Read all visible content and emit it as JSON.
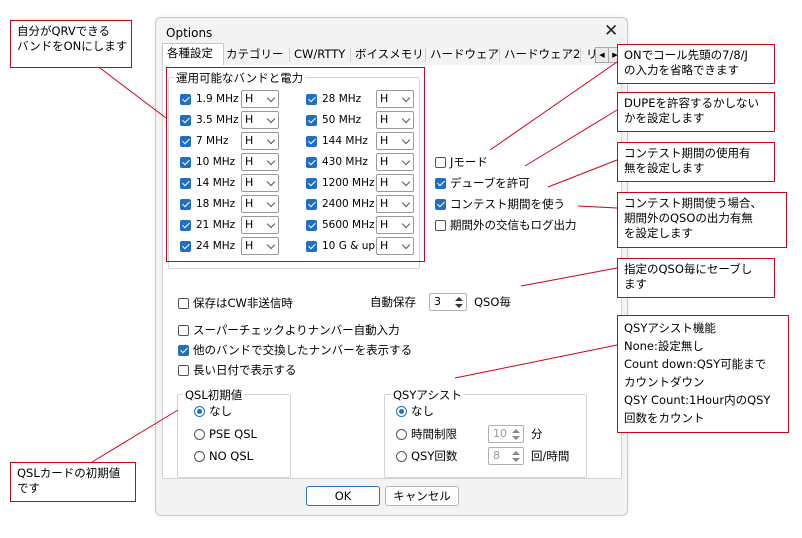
{
  "dialog": {
    "title": "Options",
    "close_glyph": "✕",
    "tabs": [
      "各種設定",
      "カテゴリー",
      "CW/RTTY",
      "ボイスメモリ",
      "ハードウェア",
      "ハードウェア2",
      "リ"
    ],
    "tab_left_glyph": "◀",
    "tab_right_glyph": "▶"
  },
  "bands": {
    "legend": "運用可能なバンドと電力",
    "left": [
      {
        "label": "1.9 MHz",
        "power": "H"
      },
      {
        "label": "3.5 MHz",
        "power": "H"
      },
      {
        "label": "7 MHz",
        "power": "H"
      },
      {
        "label": "10 MHz",
        "power": "H"
      },
      {
        "label": "14 MHz",
        "power": "H"
      },
      {
        "label": "18 MHz",
        "power": "H"
      },
      {
        "label": "21 MHz",
        "power": "H"
      },
      {
        "label": "24 MHz",
        "power": "H"
      }
    ],
    "right": [
      {
        "label": "28 MHz",
        "power": "H"
      },
      {
        "label": "50 MHz",
        "power": "H"
      },
      {
        "label": "144 MHz",
        "power": "H"
      },
      {
        "label": "430 MHz",
        "power": "H"
      },
      {
        "label": "1200 MHz",
        "power": "H"
      },
      {
        "label": "2400 MHz",
        "power": "H"
      },
      {
        "label": "5600 MHz",
        "power": "H"
      },
      {
        "label": "10 G & up",
        "power": "H"
      }
    ]
  },
  "options": {
    "j_mode": "Jモード",
    "allow_dupe": "デューブを許可",
    "use_contest_period": "コンテスト期間を使う",
    "log_outside_period": "期間外の交信もログ出力",
    "save_when_not_cw": "保存はCW非送信時",
    "auto_save_label": "自動保存",
    "auto_save_value": "3",
    "auto_save_unit": "QSO毎",
    "super_check": "スーパーチェックよりナンバー自動入力",
    "show_other_band_number": "他のバンドで交換したナンバーを表示する",
    "long_date": "長い日付で表示する"
  },
  "qsl": {
    "legend": "QSL初期値",
    "options": [
      "なし",
      "PSE QSL",
      "NO QSL"
    ]
  },
  "qsy": {
    "legend": "QSYアシスト",
    "none": "なし",
    "time_limit": "時間制限",
    "time_value": "10",
    "time_unit": "分",
    "qsy_count": "QSY回数",
    "count_value": "8",
    "count_unit": "回/時間"
  },
  "buttons": {
    "ok": "OK",
    "cancel": "キャンセル"
  },
  "annotations": {
    "qrv_bands": [
      "自分がQRVできる",
      "バンドをONにします"
    ],
    "j_mode": [
      "ONでコール先頭の7/8/J",
      "の入力を省略できます"
    ],
    "dupe": [
      "DUPEを許容するかしない",
      "かを設定します"
    ],
    "contest_period": [
      "コンテスト期間の使用有",
      "無を設定します"
    ],
    "out_of_period": [
      "コンテスト期間使う場合、",
      "期間外のQSOの出力有無",
      "を設定します"
    ],
    "auto_save": [
      "指定のQSO毎にセーブし",
      "ます"
    ],
    "qsy_assist": [
      "QSYアシスト機能",
      "None:設定無し",
      "Count down:QSY可能まで",
      "カウントダウン",
      "QSY Count:1Hour内のQSY",
      "回数をカウント"
    ],
    "qsl_default": [
      "QSLカードの初期値",
      "です"
    ]
  },
  "colors": {
    "accent": "#1f6fc5",
    "annotation": "#d0021b"
  }
}
